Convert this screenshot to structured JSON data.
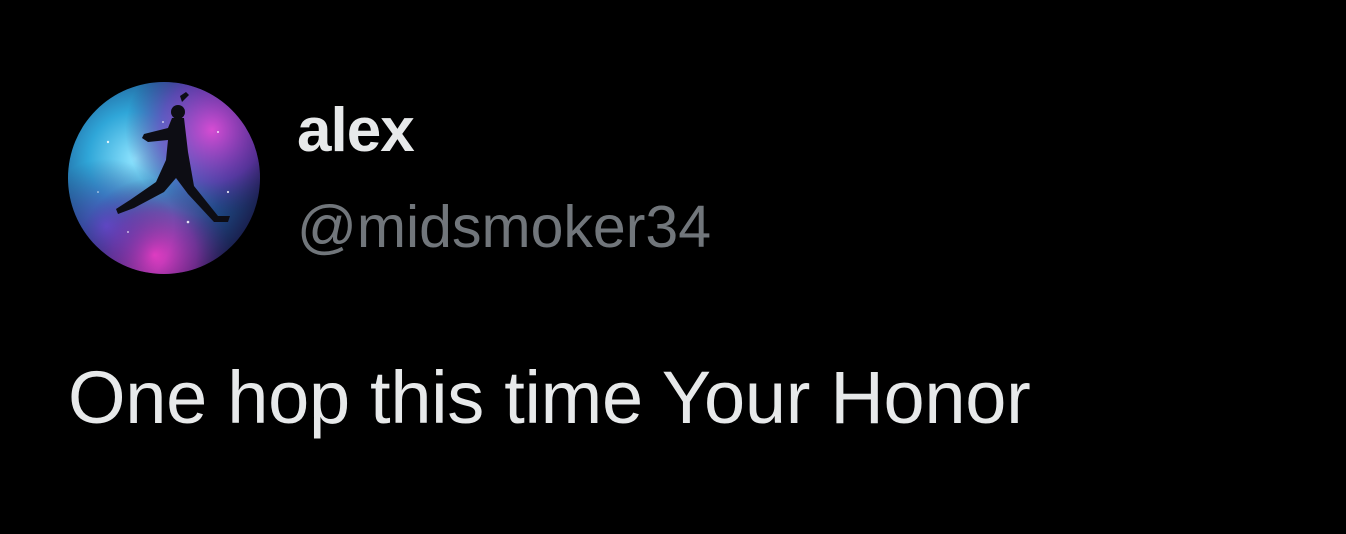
{
  "author": {
    "display_name": "alex",
    "handle": "@midsmoker34",
    "avatar_icon": "jumpman-silhouette-galaxy-avatar"
  },
  "tweet": {
    "text": "One hop this time Your Honor"
  },
  "colors": {
    "background": "#000000",
    "primary_text": "#e7e9ea",
    "secondary_text": "#71767b"
  }
}
